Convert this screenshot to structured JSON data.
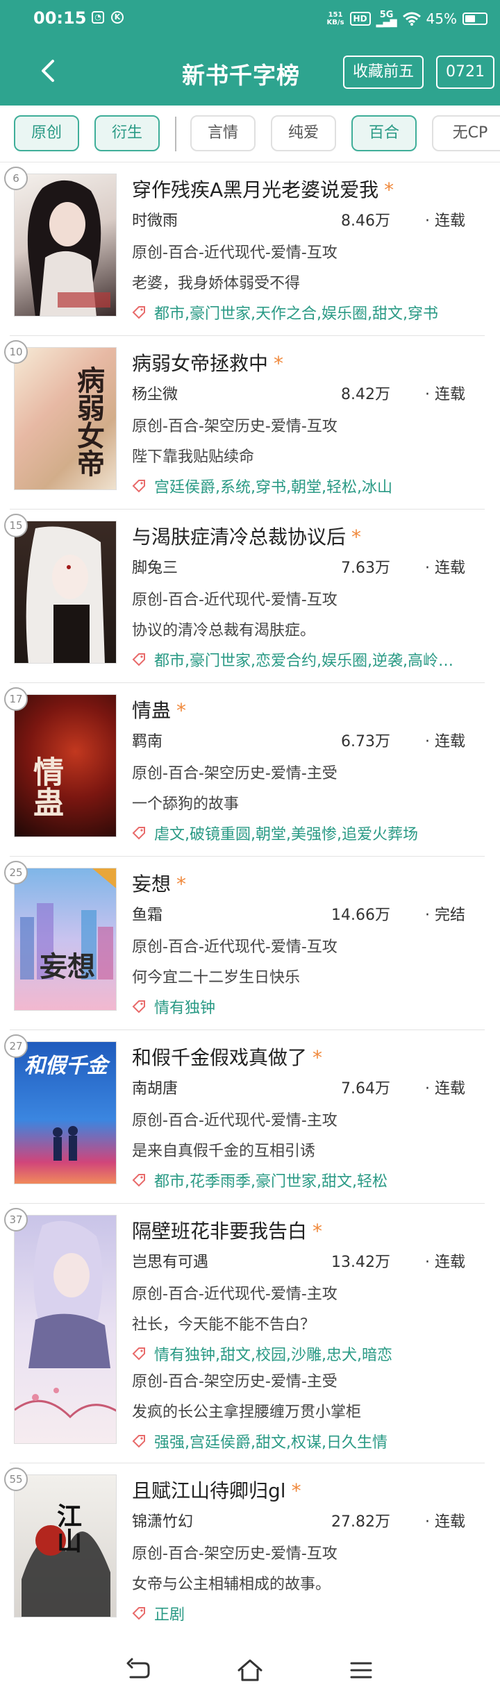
{
  "status_bar": {
    "time": "00:15",
    "net_speed_value": "151",
    "net_speed_unit": "KB/s",
    "hd": "HD",
    "signal": "5G",
    "battery": "45%"
  },
  "header": {
    "title": "新书千字榜",
    "btn_top5": "收藏前五",
    "btn_date": "0721"
  },
  "filters": [
    {
      "label": "原创",
      "active": true
    },
    {
      "label": "衍生",
      "active": true
    },
    {
      "label": "言情",
      "active": false
    },
    {
      "label": "纯爱",
      "active": false
    },
    {
      "label": "百合",
      "active": true
    },
    {
      "label": "无CP",
      "active": false
    }
  ],
  "books": [
    {
      "rank": "6",
      "cover_text": "",
      "title": "穿作残疾A黑月光老婆说爱我",
      "author": "时微雨",
      "count": "8.46万",
      "state": "· 连载",
      "meta": "原创-百合-近代现代-爱情-互攻",
      "desc": "老婆，我身娇体弱受不得",
      "tags": "都市,豪门世家,天作之合,娱乐圈,甜文,穿书"
    },
    {
      "rank": "10",
      "cover_text": "病弱女帝",
      "title": "病弱女帝拯救中",
      "author": "杨尘微",
      "count": "8.42万",
      "state": "· 连载",
      "meta": "原创-百合-架空历史-爱情-互攻",
      "desc": "陛下靠我贴贴续命",
      "tags": "宫廷侯爵,系统,穿书,朝堂,轻松,冰山"
    },
    {
      "rank": "15",
      "cover_text": "",
      "title": "与渴肤症清冷总裁协议后",
      "author": "脚兔三",
      "count": "7.63万",
      "state": "· 连载",
      "meta": "原创-百合-近代现代-爱情-互攻",
      "desc": "协议的清冷总裁有渴肤症。",
      "tags": "都市,豪门世家,恋爱合约,娱乐圈,逆袭,高岭…"
    },
    {
      "rank": "17",
      "cover_text": "情蛊",
      "title": "情蛊",
      "author": "羁南",
      "count": "6.73万",
      "state": "· 连载",
      "meta": "原创-百合-架空历史-爱情-主受",
      "desc": "一个舔狗的故事",
      "tags": "虐文,破镜重圆,朝堂,美强惨,追爱火葬场"
    },
    {
      "rank": "25",
      "cover_text": "妄想",
      "title": "妄想",
      "author": "鱼霜",
      "count": "14.66万",
      "state": "· 完结",
      "meta": "原创-百合-近代现代-爱情-互攻",
      "desc": "何今宜二十二岁生日快乐",
      "tags": "情有独钟"
    },
    {
      "rank": "27",
      "cover_text": "和假千金",
      "title": "和假千金假戏真做了",
      "author": "南胡唐",
      "count": "7.64万",
      "state": "· 连载",
      "meta": "原创-百合-近代现代-爱情-主攻",
      "desc": "是来自真假千金的互相引诱",
      "tags": "都市,花季雨季,豪门世家,甜文,轻松"
    },
    {
      "rank": "37",
      "cover_text": "",
      "title": "隔壁班花非要我告白",
      "author": "岂思有可遇",
      "count": "13.42万",
      "state": "· 连载",
      "meta": "原创-百合-近代现代-爱情-主攻",
      "desc": "社长，今天能不能不告白？",
      "tags": "情有独钟,甜文,校园,沙雕,忠犬,暗恋",
      "meta2": "原创-百合-架空历史-爱情-主受",
      "desc2": "发疯的长公主拿捏腰缠万贯小掌柜",
      "tags2": "强强,宫廷侯爵,甜文,权谋,日久生情"
    },
    {
      "rank": "55",
      "cover_text": "江山",
      "title": "且赋江山待卿归gl",
      "author": "锦潇竹幻",
      "count": "27.82万",
      "state": "· 连载",
      "meta": "原创-百合-架空历史-爱情-互攻",
      "desc": "女帝与公主相辅相成的故事。",
      "tags": "正剧"
    }
  ],
  "theme": {
    "primary": "#2ea48f",
    "accent_star": "#f08a3e",
    "tag_color": "#2a9a85"
  }
}
